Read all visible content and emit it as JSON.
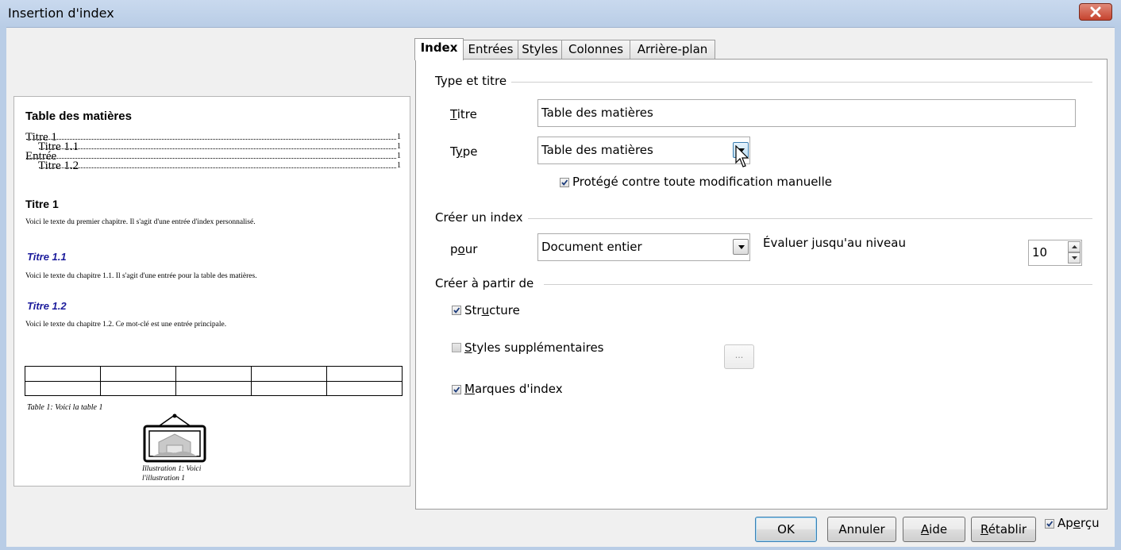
{
  "window": {
    "title": "Insertion d'index"
  },
  "tabs": [
    {
      "label": "Index",
      "active": true
    },
    {
      "label": "Entrées",
      "active": false
    },
    {
      "label": "Styles",
      "active": false
    },
    {
      "label": "Colonnes",
      "active": false
    },
    {
      "label": "Arrière-plan",
      "active": false
    }
  ],
  "preview": {
    "heading": "Table des matières",
    "toc": [
      {
        "label": "Titre 1",
        "page": "1"
      },
      {
        "label": "Titre 1.1",
        "page": "1"
      },
      {
        "label": "Entrée",
        "page": "1"
      },
      {
        "label": "Titre 1.2",
        "page": "1"
      }
    ],
    "h1": "Titre 1",
    "text1": "Voici le texte du premier chapitre. Il s'agit d'une entrée d'index personnalisé.",
    "h11": "Titre 1.1",
    "text11": "Voici le texte du chapitre 1.1. Il s'agit d'une entrée pour la table des matières.",
    "h12": "Titre 1.2",
    "text12": "Voici le texte du chapitre 1.2. Ce mot-clé est une entrée principale.",
    "table_caption": "Table 1: Voici la table 1",
    "illustration_caption_line1": "Illustration 1: Voici",
    "illustration_caption_line2": "l'illustration 1"
  },
  "type_title": {
    "group_label": "Type et titre",
    "title_label_u": "T",
    "title_label_rest": "itre",
    "title_value": "Table des matières",
    "type_label_pre": "T",
    "type_label_u": "y",
    "type_label_rest": "pe",
    "type_value": "Table des matières",
    "protected_pre": "Proté",
    "protected_u": "g",
    "protected_rest": "é contre toute modification manuelle",
    "protected_checked": true
  },
  "create_index": {
    "group_label": "Créer un index",
    "for_label_pre": "p",
    "for_label_u": "o",
    "for_label_rest": "ur",
    "for_value": "Document entier",
    "level_label_pre": "Évaluer ",
    "level_label_u": "j",
    "level_label_rest": "usqu'au niveau",
    "level_value": "10"
  },
  "create_from": {
    "group_label": "Créer à partir de",
    "structure_pre": "Str",
    "structure_u": "u",
    "structure_rest": "cture",
    "structure_checked": true,
    "extra_styles_u": "S",
    "extra_styles_rest": "tyles supplémentaires",
    "extra_styles_checked": false,
    "extra_styles_button": "...",
    "index_marks_u": "M",
    "index_marks_rest": "arques d'index",
    "index_marks_checked": true
  },
  "buttons": {
    "ok": "OK",
    "cancel": "Annuler",
    "help_u": "A",
    "help_rest": "ide",
    "reset_u": "R",
    "reset_rest": "établir",
    "preview_pre": "Ap",
    "preview_u": "e",
    "preview_rest": "rçu",
    "preview_checked": true
  },
  "colors": {
    "titlebar": "#b9cde6",
    "close": "#c6432e",
    "heading_blue": "#1c1c9c"
  }
}
